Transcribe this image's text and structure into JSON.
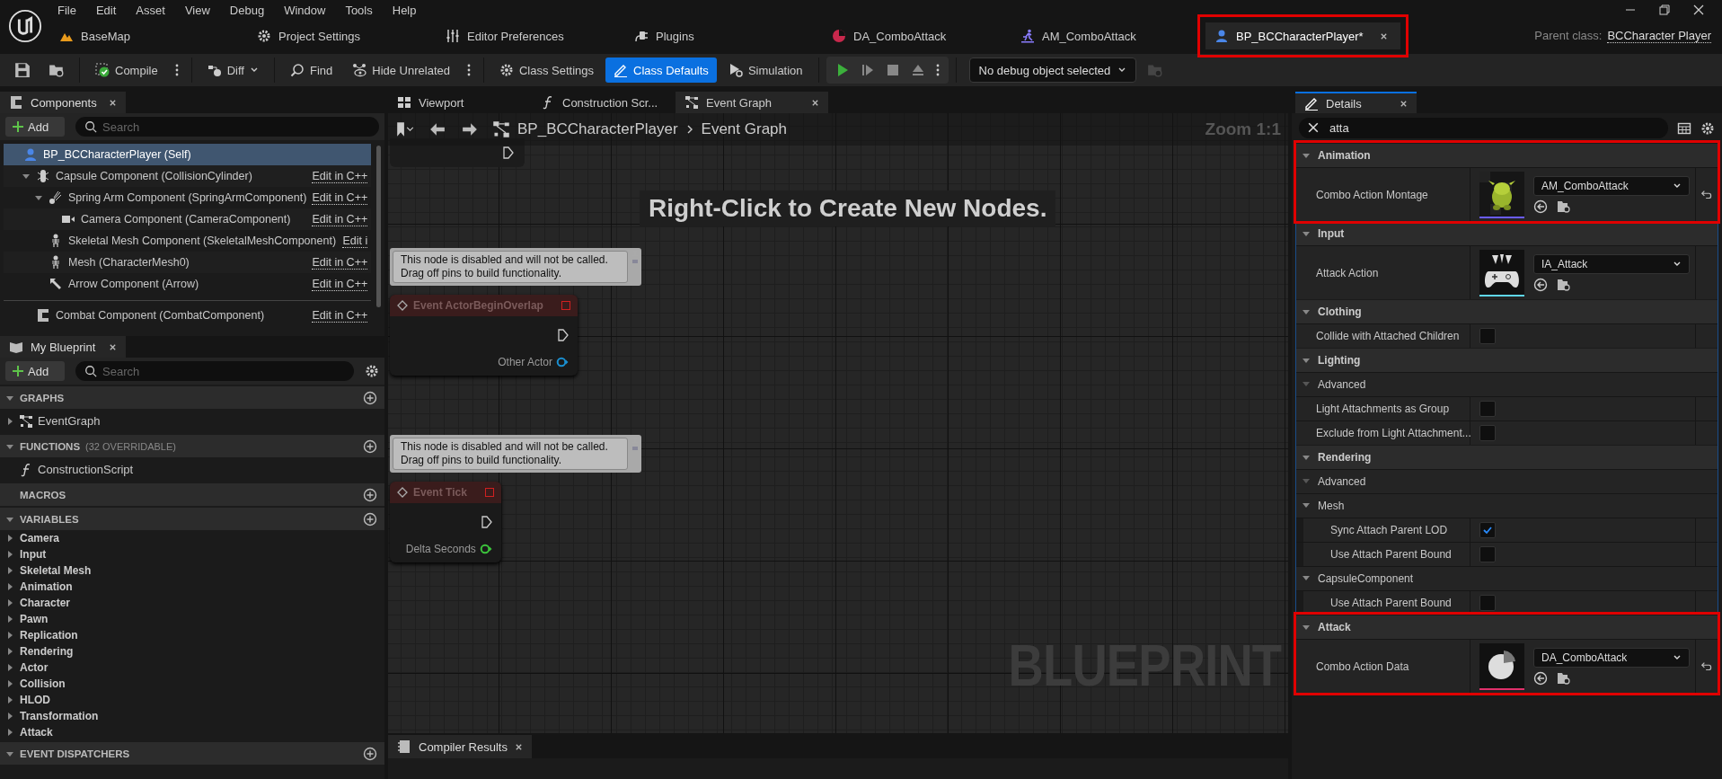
{
  "menu": [
    "File",
    "Edit",
    "Asset",
    "View",
    "Debug",
    "Window",
    "Tools",
    "Help"
  ],
  "document_tabs": [
    {
      "label": "BaseMap",
      "selected": false,
      "highlighted": false
    },
    {
      "label": "Project Settings",
      "selected": false,
      "highlighted": false
    },
    {
      "label": "Editor Preferences",
      "selected": false,
      "highlighted": false
    },
    {
      "label": "Plugins",
      "selected": false,
      "highlighted": false
    },
    {
      "label": "DA_ComboAttack",
      "selected": false,
      "highlighted": false
    },
    {
      "label": "AM_ComboAttack",
      "selected": false,
      "highlighted": false
    },
    {
      "label": "BP_BCCharacterPlayer*",
      "selected": true,
      "highlighted": true
    }
  ],
  "parent_class": {
    "label": "Parent class:",
    "value": "BCCharacter Player"
  },
  "toolbar": [
    {
      "label": "Compile",
      "selected": false
    },
    {
      "label": "Diff",
      "selected": false
    },
    {
      "label": "Find",
      "selected": false
    },
    {
      "label": "Hide Unrelated",
      "selected": false
    },
    {
      "label": "Class Settings",
      "selected": false
    },
    {
      "label": "Class Defaults",
      "selected": true
    },
    {
      "label": "Simulation",
      "selected": false
    }
  ],
  "debug_dropdown": "No debug object selected",
  "components": {
    "title": "Components",
    "selected": false,
    "add": "Add",
    "search_placeholder": "Search",
    "tree": [
      {
        "label": "BP_BCCharacterPlayer (Self)",
        "kind": "self",
        "selected": true,
        "children": [
          {
            "label": "Capsule Component (CollisionCylinder)",
            "kind": "capsule",
            "link": "Edit in C++",
            "selected": false,
            "expanded": true,
            "children": [
              {
                "label": "Spring Arm Component (SpringArmComponent)",
                "kind": "spring",
                "link": "Edit in C++",
                "selected": false,
                "expanded": true,
                "children": [
                  {
                    "label": "Camera Component (CameraComponent)",
                    "kind": "camera",
                    "link": "Edit in C++",
                    "selected": false
                  }
                ]
              },
              {
                "label": "Skeletal Mesh Component (SkeletalMeshComponent)",
                "kind": "skeleton",
                "link": "Edit i",
                "selected": false
              },
              {
                "label": "Mesh (CharacterMesh0)",
                "kind": "skeleton",
                "link": "Edit in C++",
                "selected": false
              },
              {
                "label": "Arrow Component (Arrow)",
                "kind": "arrow",
                "link": "Edit in C++",
                "selected": false
              }
            ]
          }
        ]
      }
    ],
    "extra": [
      {
        "label": "Combat Component (CombatComponent)",
        "kind": "component",
        "link": "Edit in C++",
        "selected": false
      }
    ]
  },
  "my_blueprint": {
    "title": "My Blueprint",
    "selected": false,
    "add": "Add",
    "search_placeholder": "Search",
    "sections": [
      {
        "title": "GRAPHS",
        "expanded": true,
        "items": [
          {
            "label": "EventGraph",
            "kind": "graph"
          }
        ]
      },
      {
        "title": "FUNCTIONS",
        "note": "(32 OVERRIDABLE)",
        "expanded": true,
        "items": [
          {
            "label": "ConstructionScript",
            "kind": "function"
          }
        ]
      },
      {
        "title": "MACROS"
      },
      {
        "title": "VARIABLES",
        "expanded": true,
        "categories": [
          "Camera",
          "Input",
          "Skeletal Mesh",
          "Animation",
          "Character",
          "Pawn",
          "Replication",
          "Rendering",
          "Actor",
          "Collision",
          "HLOD",
          "Transformation",
          "Attack"
        ]
      },
      {
        "title": "EVENT DISPATCHERS",
        "expanded": true
      }
    ]
  },
  "graph": {
    "tabs": [
      {
        "label": "Viewport",
        "selected": false
      },
      {
        "label": "Construction Scr...",
        "selected": false
      },
      {
        "label": "Event Graph",
        "selected": true
      }
    ],
    "breadcrumb": [
      "BP_BCCharacterPlayer",
      "Event Graph"
    ],
    "zoom": "Zoom 1:1",
    "hint": "Right-Click to Create New Nodes.",
    "nodes": [
      {
        "comment": [
          "This node is disabled and will not be called.",
          "Drag off pins to build functionality."
        ],
        "title": "Event ActorBeginOverlap",
        "output": "Other Actor",
        "color": "#1a8fd0"
      },
      {
        "comment": [
          "This node is disabled and will not be called.",
          "Drag off pins to build functionality."
        ],
        "title": "Event Tick",
        "output": "Delta Seconds",
        "color": "#3cc43c"
      }
    ],
    "watermark": "BLUEPRINT"
  },
  "compiler_tab": {
    "title": "Compiler Results",
    "selected": false
  },
  "details": {
    "title": "Details",
    "selected": true,
    "search": "atta",
    "sections": [
      {
        "title": "Animation",
        "highlighted": true,
        "rows": [
          {
            "kind": "asset",
            "label": "Combo Action Montage",
            "value": "AM_ComboAttack",
            "color": "#6a5cff",
            "reset": true
          }
        ]
      },
      {
        "title": "Input",
        "highlighted": false,
        "rows": [
          {
            "kind": "asset",
            "label": "Attack Action",
            "value": "IA_Attack",
            "color": "#5fd6ea",
            "reset": false
          }
        ]
      },
      {
        "title": "Clothing",
        "highlighted": false,
        "rows": [
          {
            "kind": "checkbox",
            "label": "Collide with Attached Children",
            "checked": false
          }
        ]
      },
      {
        "title": "Lighting",
        "highlighted": false,
        "rows": [
          {
            "kind": "group",
            "label": "Advanced",
            "expanded": false
          },
          {
            "kind": "checkbox",
            "label": "Light Attachments as Group",
            "checked": false
          },
          {
            "kind": "checkbox",
            "label": "Exclude from Light Attachment...",
            "checked": false
          }
        ]
      },
      {
        "title": "Rendering",
        "highlighted": false,
        "rows": [
          {
            "kind": "group",
            "label": "Advanced",
            "expanded": false
          },
          {
            "kind": "group",
            "label": "Mesh",
            "expanded": true
          },
          {
            "kind": "checkbox",
            "label": "Sync Attach Parent LOD",
            "checked": true,
            "nested": true
          },
          {
            "kind": "checkbox",
            "label": "Use Attach Parent Bound",
            "checked": false,
            "nested": true
          },
          {
            "kind": "group",
            "label": "CapsuleComponent",
            "expanded": true
          },
          {
            "kind": "checkbox",
            "label": "Use Attach Parent Bound",
            "checked": false,
            "nested": true
          }
        ]
      },
      {
        "title": "Attack",
        "highlighted": true,
        "rows": [
          {
            "kind": "asset",
            "label": "Combo Action Data",
            "value": "DA_ComboAttack",
            "color": "#e0306a",
            "reset": true
          }
        ]
      }
    ]
  }
}
